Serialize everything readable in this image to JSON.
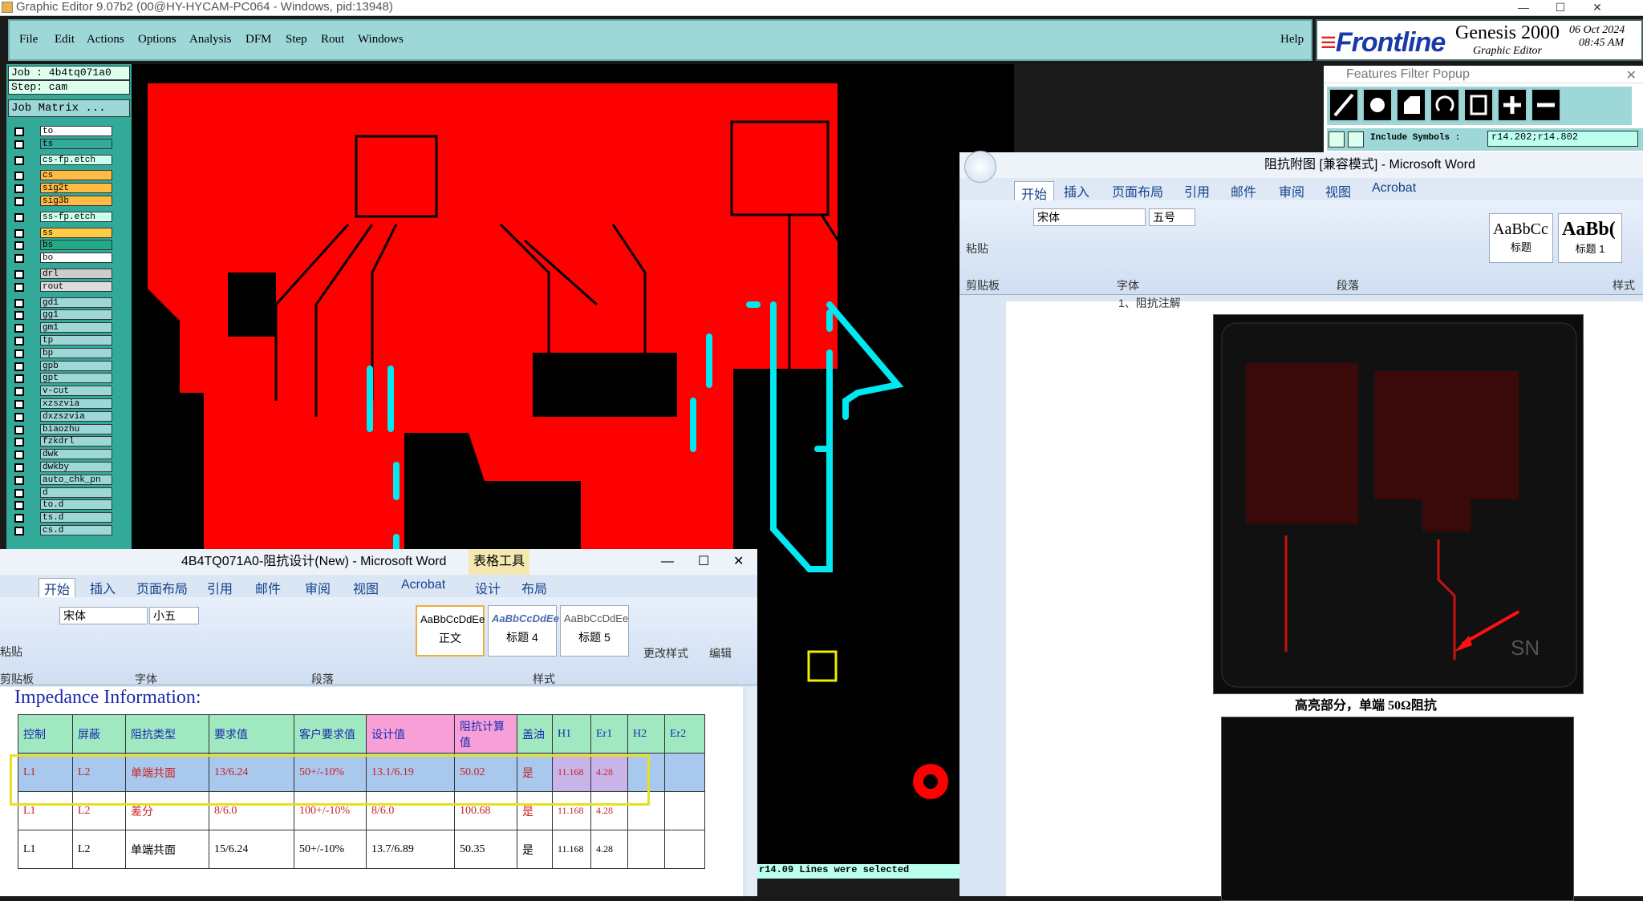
{
  "window_title": "Graphic Editor 9.07b2 (00@HY-HYCAM-PC064 - Windows, pid:13948)",
  "genesis": {
    "menu": [
      "File",
      "Edit",
      "Actions",
      "Options",
      "Analysis",
      "DFM",
      "Step",
      "Rout",
      "Windows"
    ],
    "help": "Help",
    "logo": "Frontline",
    "product": "Genesis 2000",
    "subtitle": "Graphic Editor",
    "date": "06 Oct 2024",
    "time": "08:45 AM",
    "job": "Job : 4b4tq071a0",
    "step": "Step: cam",
    "job_matrix": "Job Matrix ...",
    "layers": [
      "to",
      "ts",
      "cs-fp.etch",
      "cs",
      "sig2t",
      "sig3b",
      "ss-fp.etch",
      "ss",
      "bs",
      "bo",
      "drl",
      "rout",
      "gd1",
      "gg1",
      "gm1",
      "tp",
      "bp",
      "gpb",
      "gpt",
      "v-cut",
      "xzszvia",
      "dxzszvia",
      "biaozhu",
      "fzkdrl",
      "dwk",
      "dwkby",
      "auto_chk_pn",
      "d",
      "to.d",
      "ts.d",
      "cs.d"
    ],
    "status": "r14.09 Lines were selected"
  },
  "features_popup": {
    "title": "Features Filter Popup",
    "include_symbols": "Include Symbols :",
    "symbols_value": "r14.202;r14.802"
  },
  "word_right": {
    "title": "阻抗附图 [兼容模式] - Microsoft Word",
    "tabs": [
      "开始",
      "插入",
      "页面布局",
      "引用",
      "邮件",
      "审阅",
      "视图",
      "Acrobat"
    ],
    "font": "宋体",
    "size": "五号",
    "groups": [
      "剪贴板",
      "字体",
      "段落",
      "样式"
    ],
    "paste": "粘贴",
    "styles": [
      "AaBbCc",
      "AaBb(",
      "标题",
      "标题 1"
    ],
    "heading_fragment": "1、阻抗注解",
    "caption": "高亮部分，单端 50Ω阻抗",
    "board_label": "SN"
  },
  "word_left": {
    "title": "4B4TQ071A0-阻抗设计(New) - Microsoft Word",
    "context_tab": "表格工具",
    "tabs": [
      "开始",
      "插入",
      "页面布局",
      "引用",
      "邮件",
      "审阅",
      "视图",
      "Acrobat",
      "设计",
      "布局"
    ],
    "font": "宋体",
    "size": "小五",
    "groups": [
      "剪贴板",
      "字体",
      "段落",
      "样式"
    ],
    "paste": "粘贴",
    "styles": [
      {
        "sample": "AaBbCcDdEe",
        "name": "正文"
      },
      {
        "sample": "AaBbCcDdEe",
        "name": "标题 4"
      },
      {
        "sample": "AaBbCcDdEe",
        "name": "标题 5"
      }
    ],
    "change_style": "更改样式",
    "edit": "编辑",
    "doc_heading": "Impedance Information:",
    "table_header": [
      "控制",
      "屏蔽",
      "阻抗类型",
      "要求值",
      "客户要求值",
      "设计值",
      "阻抗计算值",
      "盖油",
      "H1",
      "Er1",
      "H2",
      "Er2"
    ],
    "rows": [
      [
        "L1",
        "L2",
        "单端共面",
        "13/6.24",
        "50+/-10%",
        "13.1/6.19",
        "50.02",
        "是",
        "11.168",
        "4.28",
        "",
        ""
      ],
      [
        "L1",
        "L2",
        "差分",
        "8/6.0",
        "100+/-10%",
        "8/6.0",
        "100.68",
        "是",
        "11.168",
        "4.28",
        "",
        ""
      ],
      [
        "L1",
        "L2",
        "单端共面",
        "15/6.24",
        "50+/-10%",
        "13.7/6.89",
        "50.35",
        "是",
        "11.168",
        "4.28",
        "",
        ""
      ]
    ]
  }
}
